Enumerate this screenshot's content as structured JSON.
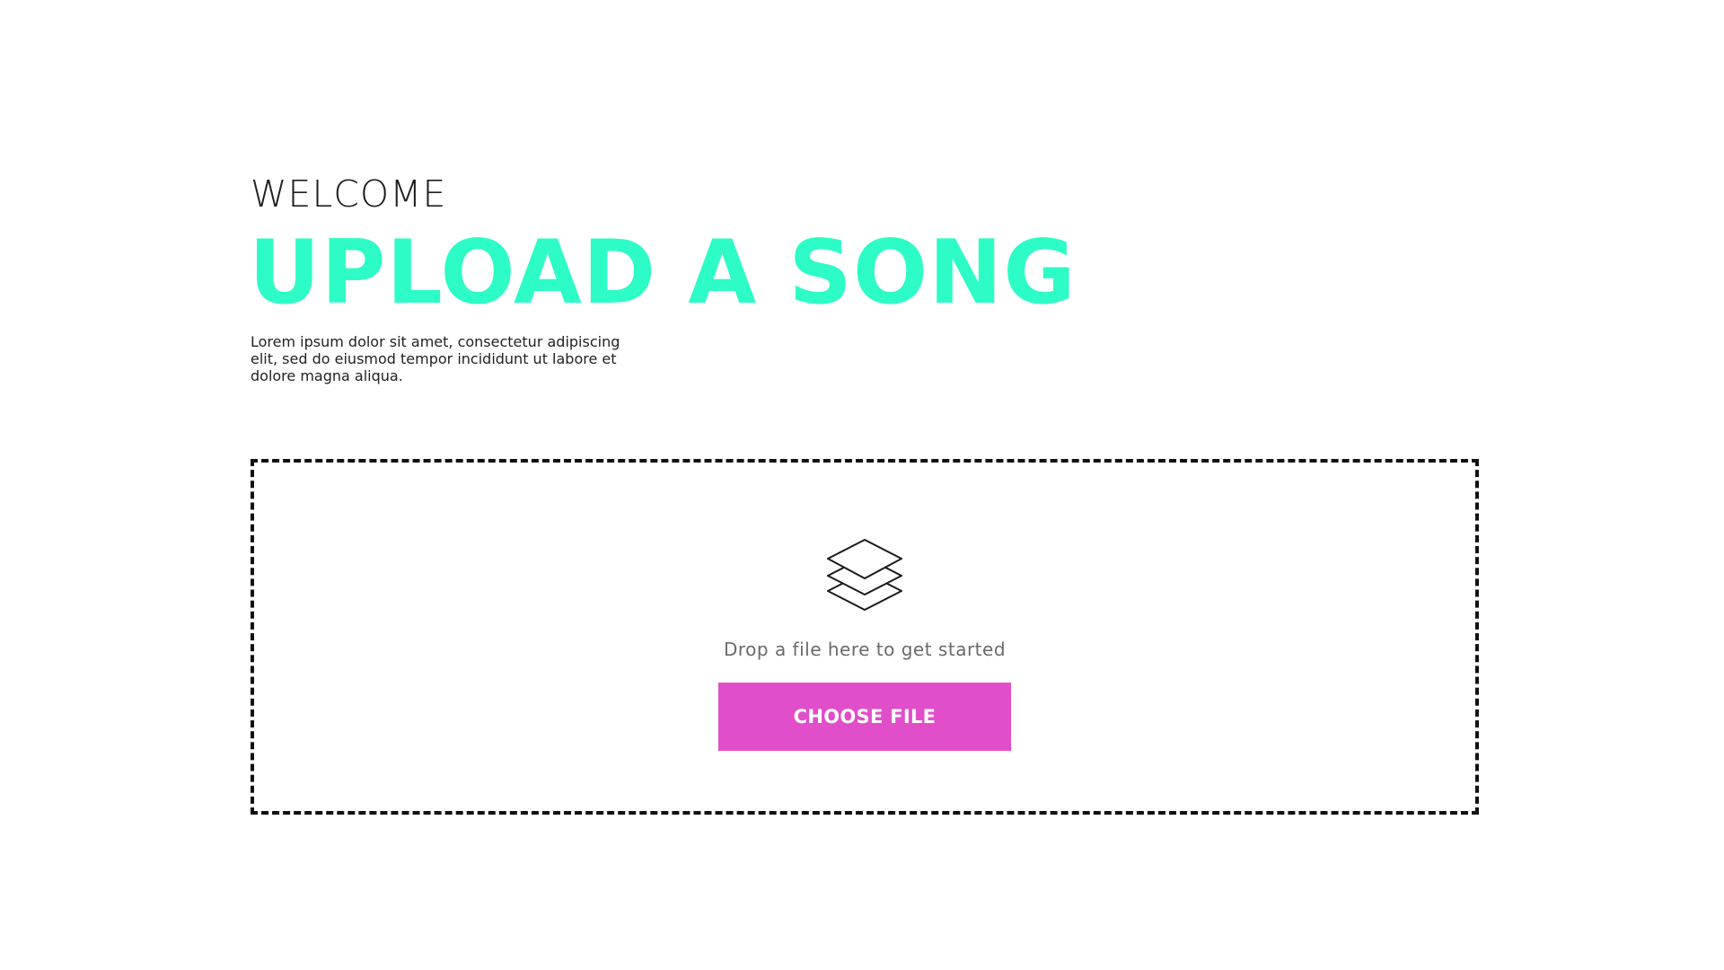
{
  "hero": {
    "eyebrow": "WELCOME",
    "headline": "UPLOAD A SONG",
    "intro": "Lorem ipsum dolor sit amet, consectetur adipiscing elit, sed do eiusmod tempor incididunt ut labore et dolore magna aliqua."
  },
  "dropzone": {
    "icon": "layers-icon",
    "prompt": "Drop a file here to get started",
    "button_label": "CHOOSE FILE"
  },
  "colors": {
    "accent": "#2dfcc6",
    "button": "#e04ec9",
    "text": "#1f1f1f",
    "muted": "#6a6a6a",
    "border": "#111111"
  }
}
